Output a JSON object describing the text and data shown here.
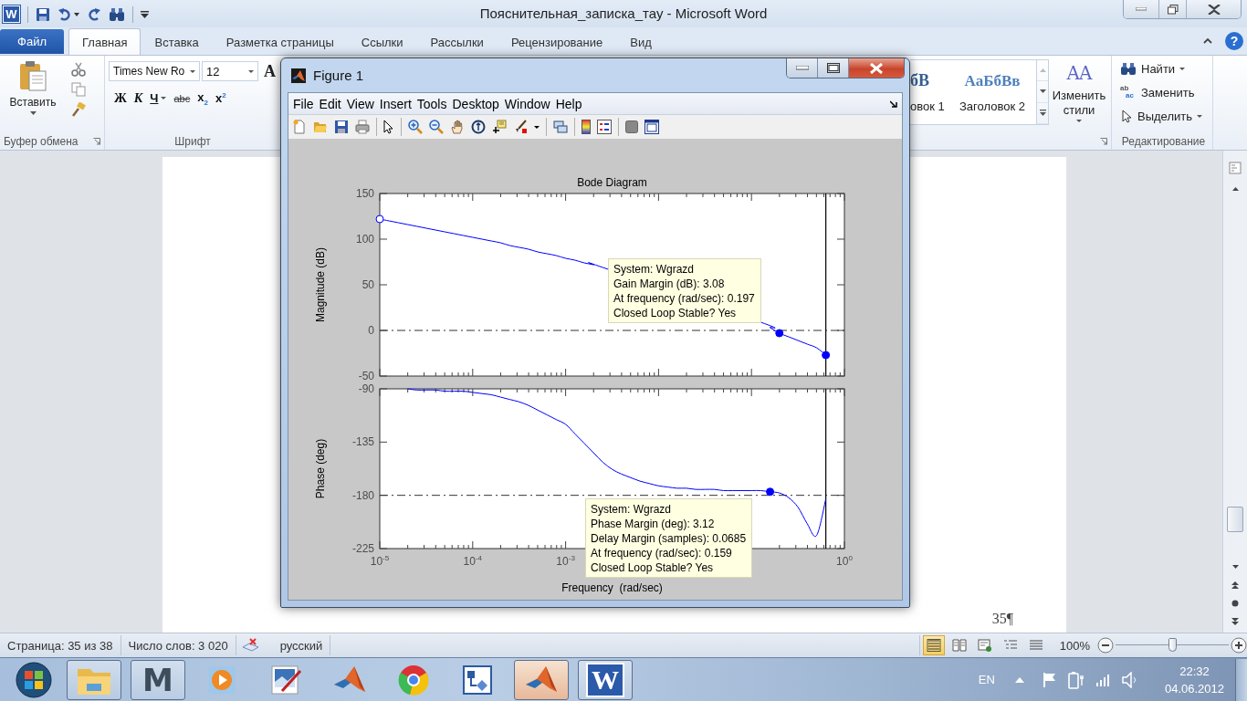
{
  "word": {
    "logo": "W",
    "title": "Пояснительная_записка_тау - Microsoft Word",
    "help": "?",
    "tabs": [
      {
        "label": "Файл",
        "kind": "file",
        "selected": false
      },
      {
        "label": "Главная",
        "kind": "tab",
        "selected": true
      },
      {
        "label": "Вставка",
        "kind": "tab",
        "selected": false
      },
      {
        "label": "Разметка страницы",
        "kind": "tab",
        "selected": false
      },
      {
        "label": "Ссылки",
        "kind": "tab",
        "selected": false
      },
      {
        "label": "Рассылки",
        "kind": "tab",
        "selected": false
      },
      {
        "label": "Рецензирование",
        "kind": "tab",
        "selected": false
      },
      {
        "label": "Вид",
        "kind": "tab",
        "selected": false
      }
    ],
    "clipboard": {
      "paste": "Вставить",
      "group": "Буфер обмена"
    },
    "font": {
      "name": "Times New Ro",
      "size": "12",
      "grow": "A",
      "group": "Шрифт",
      "format": [
        {
          "label": "Ж",
          "kind": "bold"
        },
        {
          "label": "К",
          "kind": "italic"
        },
        {
          "label": "Ч",
          "kind": "underline"
        },
        {
          "label": "abc",
          "kind": "strike"
        },
        {
          "label": "x$_{2}$",
          "kind": "script"
        },
        {
          "label": "x$^{2}$",
          "kind": "script"
        }
      ]
    },
    "styles": [
      {
        "sample": "бВ",
        "name": "овок 1",
        "kind": "heading1"
      },
      {
        "sample": "АаБбВв",
        "name": "Заголовок 2",
        "kind": "heading2"
      }
    ],
    "change_styles": {
      "glyph": "AA",
      "label": "Изменить стили"
    },
    "editing": {
      "find": "Найти",
      "replace_glyph": [
        "ab",
        "ac"
      ],
      "replace": "Заменить",
      "select": "Выделить",
      "group": "Редактирование"
    },
    "page_number": "35¶",
    "status": {
      "page": "Страница: 35 из 38",
      "words": "Число слов: 3 020",
      "language": "русский",
      "views": [
        {
          "selected": true
        },
        {
          "selected": false
        },
        {
          "selected": false
        },
        {
          "selected": false
        },
        {
          "selected": false
        }
      ],
      "zoom": "100%",
      "zoom_slider": {
        "level": 0.5
      }
    }
  },
  "figure": {
    "title": "Figure 1",
    "menu": [
      "File",
      "Edit",
      "View",
      "Insert",
      "Tools",
      "Desktop",
      "Window",
      "Help"
    ],
    "charts": [
      {
        "chart_data": {
          "type": "line",
          "title": "Bode Diagram",
          "ylabel": "Magnitude (dB)",
          "categories": [
            null,
            null,
            null,
            null,
            null,
            null,
            null,
            null,
            null,
            null,
            null,
            null,
            null,
            null,
            null,
            null,
            null,
            null,
            null,
            null,
            null,
            null,
            null,
            null,
            null,
            null,
            null,
            null,
            null,
            null,
            null,
            null,
            null,
            null,
            null,
            null,
            null,
            null,
            null,
            null,
            null,
            null,
            null,
            null,
            null,
            null,
            null,
            null,
            null,
            null,
            null
          ],
          "series": [
            {
              "color": "#0000ff",
              "values": [
                122,
                120,
                118,
                116,
                114,
                112,
                110,
                108,
                106,
                104,
                102,
                100,
                98,
                96,
                93,
                91,
                89,
                86,
                84,
                82,
                79,
                77,
                74,
                72,
                69,
                null,
                null,
                null,
                null,
                null,
                null,
                null,
                null,
                null,
                null,
                null,
                null,
                null,
                null,
                null,
                null,
                9,
                3,
                -3,
                -7,
                -11,
                -15,
                -19,
                -27,
                null,
                null
              ]
            },
            {
              "color": "#0000ff",
              "marker": "circle",
              "values": [
                null,
                null,
                null,
                null,
                null,
                null,
                null,
                null,
                null,
                null,
                null,
                null,
                null,
                null,
                null,
                null,
                null,
                null,
                null,
                null,
                null,
                null,
                null,
                null,
                null,
                null,
                null,
                null,
                null,
                null,
                null,
                null,
                null,
                null,
                null,
                null,
                null,
                null,
                null,
                null,
                null,
                null,
                null,
                -3,
                null,
                null,
                null,
                null,
                null,
                null,
                null
              ]
            },
            {
              "color": "#ffffff",
              "marker": "circle",
              "values": [
                122,
                null,
                null,
                null,
                null,
                null,
                null,
                null,
                null,
                null,
                null,
                null,
                null,
                null,
                null,
                null,
                null,
                null,
                null,
                null,
                null,
                null,
                null,
                null,
                null,
                null,
                null,
                null,
                null,
                null,
                null,
                null,
                null,
                null,
                null,
                null,
                null,
                null,
                null,
                null,
                null,
                null,
                null,
                null,
                null,
                null,
                null,
                null,
                null,
                null,
                null
              ]
            },
            {
              "color": "#0000ff",
              "marker": "circle",
              "values": [
                null,
                null,
                null,
                null,
                null,
                null,
                null,
                null,
                null,
                null,
                null,
                null,
                null,
                null,
                null,
                null,
                null,
                null,
                null,
                null,
                null,
                null,
                null,
                null,
                null,
                null,
                null,
                null,
                null,
                null,
                null,
                null,
                null,
                null,
                null,
                null,
                null,
                null,
                null,
                null,
                null,
                null,
                null,
                null,
                null,
                null,
                null,
                null,
                -27,
                null,
                null
              ]
            }
          ],
          "ylim": [
            -50,
            150
          ],
          "yticks": [
            -50,
            0,
            50,
            100,
            150
          ],
          "ref_lines": [
            {
              "axis": "y",
              "value": 0
            }
          ]
        }
      },
      {
        "chart_data": {
          "type": "line",
          "xlabel": "Frequency  (rad/sec)",
          "ylabel": "Phase (deg)",
          "categories": [
            "10$^{-5}$",
            null,
            null,
            null,
            null,
            null,
            null,
            null,
            null,
            null,
            "10$^{-4}$",
            null,
            null,
            null,
            null,
            null,
            null,
            null,
            null,
            null,
            "10$^{-3}$",
            null,
            null,
            null,
            null,
            null,
            null,
            null,
            null,
            null,
            null,
            null,
            null,
            null,
            null,
            null,
            null,
            null,
            null,
            null,
            null,
            null,
            null,
            null,
            null,
            null,
            null,
            null,
            null,
            null,
            "10$^{0}$"
          ],
          "series": [
            {
              "color": "#0000ff",
              "values": [
                null,
                null,
                null,
                -90,
                -91,
                -91,
                -91,
                -92,
                -92,
                -92,
                -93,
                -94,
                -95,
                -97,
                -99,
                -101,
                -104,
                -108,
                -112,
                -116,
                -120,
                -128,
                -136,
                -144,
                -152,
                -158,
                -162,
                -165,
                -168,
                -170,
                -172,
                -173,
                -174,
                -174,
                -175,
                -175,
                -175,
                -176,
                -176,
                -176,
                -176,
                -176,
                -177,
                -178,
                -182,
                -190,
                -204,
                -214,
                -183,
                null,
                null
              ]
            },
            {
              "color": "#0000ff",
              "marker": "circle",
              "values": [
                null,
                null,
                null,
                null,
                null,
                null,
                null,
                null,
                null,
                null,
                null,
                null,
                null,
                null,
                null,
                null,
                null,
                null,
                null,
                null,
                null,
                null,
                null,
                null,
                null,
                null,
                null,
                null,
                null,
                null,
                null,
                null,
                null,
                null,
                null,
                null,
                null,
                null,
                null,
                null,
                null,
                null,
                -177,
                null,
                null,
                null,
                null,
                null,
                null,
                null,
                null
              ]
            }
          ],
          "ylim": [
            -225,
            -90
          ],
          "yticks": [
            -225,
            -180,
            -135,
            -90
          ],
          "ref_lines": [
            {
              "axis": "y",
              "value": -180
            }
          ]
        }
      }
    ],
    "datatips": [
      {
        "lines": [
          "System: Wgrazd",
          "Gain Margin (dB): 3.08",
          "At frequency (rad/sec): 0.197",
          "Closed Loop Stable? Yes"
        ]
      },
      {
        "lines": [
          "System: Wgrazd",
          "Phase Margin (deg): 3.12",
          "Delay Margin (samples): 0.0685",
          "At frequency (rad/sec): 0.159",
          "Closed Loop Stable? Yes"
        ]
      }
    ]
  },
  "taskbar": {
    "apps": [
      {
        "running": true,
        "selected": false
      },
      {
        "running": true,
        "selected": false,
        "glyph": "M"
      },
      {
        "running": false,
        "selected": false
      },
      {
        "running": false,
        "selected": false
      },
      {
        "running": false,
        "selected": false
      },
      {
        "running": false,
        "selected": false
      },
      {
        "running": false,
        "selected": false
      },
      {
        "running": true,
        "selected": true
      },
      {
        "running": true,
        "selected": false,
        "glyph": "W"
      }
    ],
    "language": "EN",
    "time": "22:32",
    "date": "04.06.2012"
  }
}
